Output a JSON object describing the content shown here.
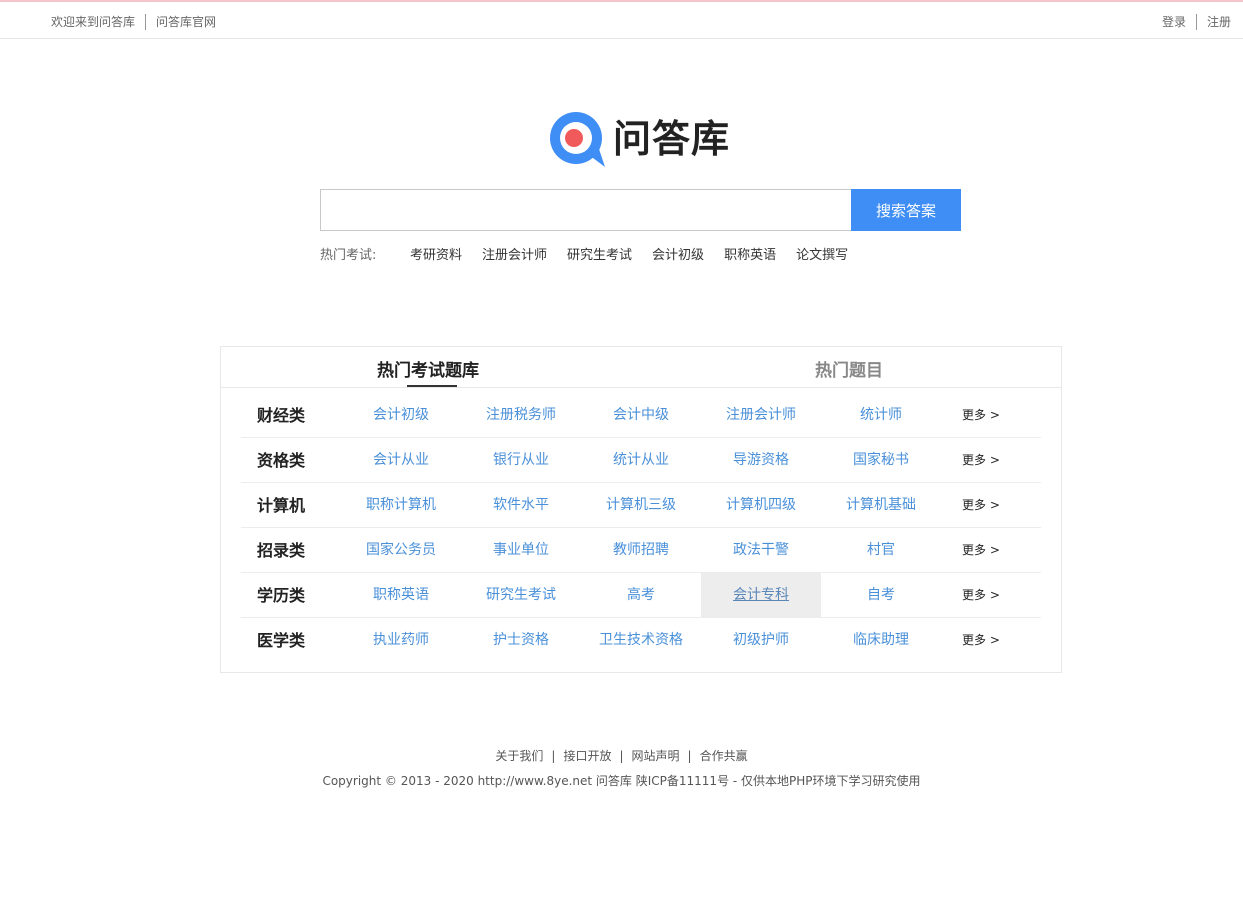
{
  "topbar": {
    "welcome": "欢迎来到问答库",
    "official_site": "问答库官网",
    "login": "登录",
    "register": "注册"
  },
  "logo": {
    "text": "问答库"
  },
  "search": {
    "placeholder": "",
    "button": "搜索答案"
  },
  "hot_exams": {
    "label": "热门考试:",
    "links": [
      "考研资料",
      "注册会计师",
      "研究生考试",
      "会计初级",
      "职称英语",
      "论文撰写"
    ]
  },
  "tabs": {
    "active": "热门考试题库",
    "inactive": "热门题目"
  },
  "categories": [
    {
      "name": "财经类",
      "items": [
        "会计初级",
        "注册税务师",
        "会计中级",
        "注册会计师",
        "统计师"
      ],
      "more": "更多 >"
    },
    {
      "name": "资格类",
      "items": [
        "会计从业",
        "银行从业",
        "统计从业",
        "导游资格",
        "国家秘书"
      ],
      "more": "更多 >"
    },
    {
      "name": "计算机",
      "items": [
        "职称计算机",
        "软件水平",
        "计算机三级",
        "计算机四级",
        "计算机基础"
      ],
      "more": "更多 >"
    },
    {
      "name": "招录类",
      "items": [
        "国家公务员",
        "事业单位",
        "教师招聘",
        "政法干警",
        "村官"
      ],
      "more": "更多 >"
    },
    {
      "name": "学历类",
      "items": [
        "职称英语",
        "研究生考试",
        "高考",
        "会计专科",
        "自考"
      ],
      "more": "更多 >"
    },
    {
      "name": "医学类",
      "items": [
        "执业药师",
        "护士资格",
        "卫生技术资格",
        "初级护师",
        "临床助理"
      ],
      "more": "更多 >"
    }
  ],
  "footer": {
    "links": [
      "关于我们",
      "接口开放",
      "网站声明",
      "合作共赢"
    ],
    "copyright": "Copyright © 2013 - 2020 http://www.8ye.net  问答库   陕ICP备11111号 - 仅供本地PHP环境下学习研究使用"
  },
  "colors": {
    "accent": "#3f8ef5",
    "link": "#4a90d9",
    "logo_red": "#f05a5a"
  }
}
